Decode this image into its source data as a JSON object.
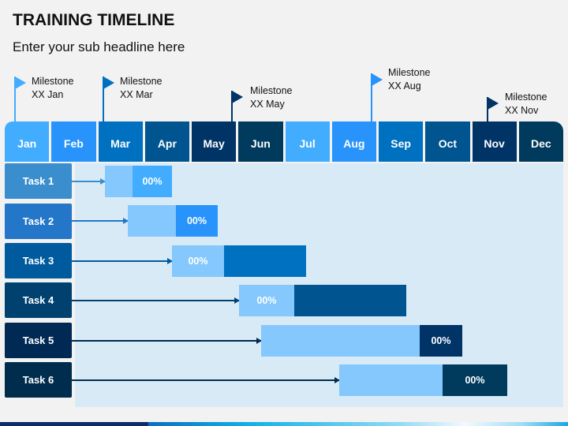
{
  "header": {
    "title": "TRAINING TIMELINE",
    "subtitle": "Enter your sub headline here"
  },
  "months": [
    {
      "label": "Jan",
      "color": "#42adff"
    },
    {
      "label": "Feb",
      "color": "#2893fb"
    },
    {
      "label": "Mar",
      "color": "#0070c0"
    },
    {
      "label": "Apr",
      "color": "#00548f"
    },
    {
      "label": "May",
      "color": "#003366"
    },
    {
      "label": "Jun",
      "color": "#003a5c"
    },
    {
      "label": "Jul",
      "color": "#42adff"
    },
    {
      "label": "Aug",
      "color": "#2893fb"
    },
    {
      "label": "Sep",
      "color": "#0070c0"
    },
    {
      "label": "Oct",
      "color": "#00548f"
    },
    {
      "label": "Nov",
      "color": "#003366"
    },
    {
      "label": "Dec",
      "color": "#003a5c"
    }
  ],
  "milestones": [
    {
      "title": "Milestone",
      "date": "XX Jan",
      "month_index": 0,
      "color": "#42adff"
    },
    {
      "title": "Milestone",
      "date": "XX Mar",
      "month_index": 2,
      "color": "#0070c0"
    },
    {
      "title": "Milestone",
      "date": "XX May",
      "month_index": 4,
      "color": "#003366"
    },
    {
      "title": "Milestone",
      "date": "XX Aug",
      "month_index": 7,
      "color": "#2893fb"
    },
    {
      "title": "Milestone",
      "date": "XX Nov",
      "month_index": 10,
      "color": "#003366"
    }
  ],
  "tasks": [
    {
      "label": "Task 1",
      "progress_label": "00%",
      "label_color": "#3a8ecd",
      "done_color": "#42adff",
      "pending_color": "#84c8fd",
      "text_on": "done"
    },
    {
      "label": "Task 2",
      "progress_label": "00%",
      "label_color": "#2376c8",
      "done_color": "#2893fb",
      "pending_color": "#84c8fd",
      "text_on": "done"
    },
    {
      "label": "Task 3",
      "progress_label": "00%",
      "label_color": "#005a9e",
      "done_color": "#0070c0",
      "pending_color": "#84c8fd",
      "text_on": "pending"
    },
    {
      "label": "Task 4",
      "progress_label": "00%",
      "label_color": "#004170",
      "done_color": "#00548f",
      "pending_color": "#84c8fd",
      "text_on": "pending"
    },
    {
      "label": "Task 5",
      "progress_label": "00%",
      "label_color": "#002a54",
      "done_color": "#003366",
      "pending_color": "#84c8fd",
      "text_on": "done"
    },
    {
      "label": "Task 6",
      "progress_label": "00%",
      "label_color": "#002d4d",
      "done_color": "#003a5c",
      "pending_color": "#84c8fd",
      "text_on": "done"
    }
  ]
}
